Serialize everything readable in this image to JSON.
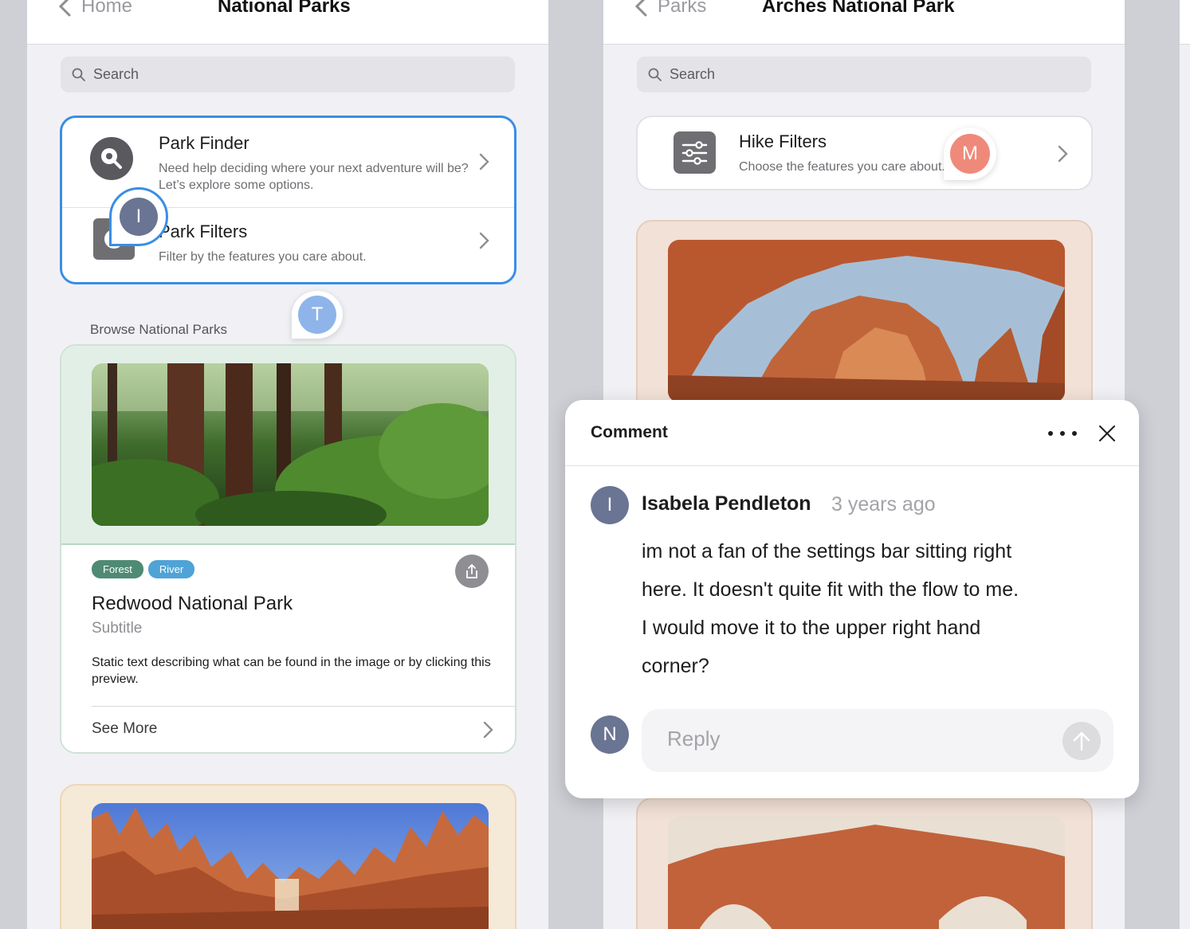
{
  "left": {
    "nav": {
      "back_label": "Home",
      "title": "National Parks"
    },
    "search": {
      "placeholder": "Search"
    },
    "menu": {
      "items": [
        {
          "title": "Park Finder",
          "description": "Need help deciding where your next adventure will be? Let’s explore some options."
        },
        {
          "title": "Park Filters",
          "description": "Filter by the features you care about."
        }
      ]
    },
    "section_label": "Browse National Parks",
    "park_card": {
      "tags": [
        "Forest",
        "River"
      ],
      "title": "Redwood National Park",
      "subtitle": "Subtitle",
      "description": "Static text describing what can be found in the image or by clicking this preview.",
      "see_more": "See More"
    }
  },
  "right": {
    "nav": {
      "back_label": "Parks",
      "title": "Arches National Park"
    },
    "search": {
      "placeholder": "Search"
    },
    "hike_filters": {
      "title": "Hike Filters",
      "description": "Choose the features you care about."
    }
  },
  "pins": {
    "i": "I",
    "t": "T",
    "m": "M"
  },
  "comment": {
    "title": "Comment",
    "author_initial": "I",
    "author": "Isabela Pendleton",
    "time": "3 years ago",
    "text_lines": [
      "im not a fan of the settings bar sitting right",
      "here. It doesn't quite fit with the flow to me.",
      "I would move it to the upper right hand",
      "corner?"
    ],
    "reply_initial": "N",
    "reply_placeholder": "Reply"
  },
  "colors": {
    "accent": "#3a8ee6",
    "tag_forest": "#4e8a74",
    "tag_river": "#4fa3d6",
    "avatar": "#6a7493",
    "pin_t": "#8fb4ea",
    "pin_m": "#ef8a7a"
  }
}
